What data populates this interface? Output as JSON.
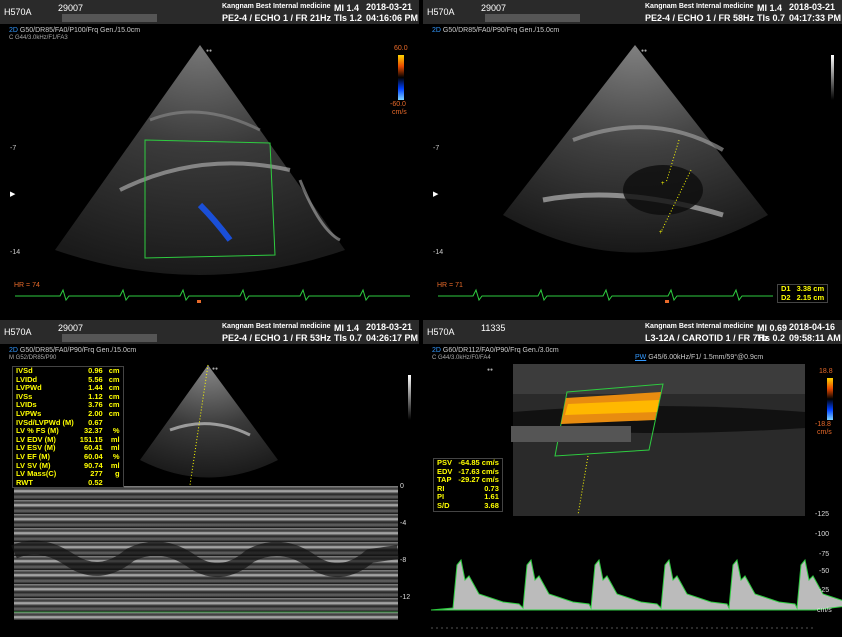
{
  "panels": {
    "q1": {
      "model": "H570A",
      "patient_id": "29007",
      "institution": "Kangnam Best Internal medicine",
      "probe": "PE2-4 / ECHO 1 / FR 21Hz",
      "mi": "MI  1.4",
      "tis": "TIs 1.2",
      "date": "2018-03-21",
      "time": "04:16:06 PM",
      "mode": "2D",
      "params": "G50/DR85/FA0/P100/Frq Gen./15.0cm",
      "params2": "C G44/3.0kHz/F1/FA3",
      "hr": "HR = 74",
      "depth": [
        "-7",
        "-14"
      ],
      "color_scale": {
        "top": "60.0",
        "bottom": "-60.0",
        "unit": "cm/s"
      }
    },
    "q2": {
      "model": "H570A",
      "patient_id": "29007",
      "institution": "Kangnam Best Internal medicine",
      "probe": "PE2-4 / ECHO 1 / FR 58Hz",
      "mi": "MI  1.4",
      "tis": "TIs 0.7",
      "date": "2018-03-21",
      "time": "04:17:33 PM",
      "mode": "2D",
      "params": "G50/DR85/FA0/P90/Frq Gen./15.0cm",
      "hr": "HR = 71",
      "depth": [
        "-7",
        "-14"
      ],
      "measurements": [
        {
          "label": "D1",
          "value": "3.38 cm"
        },
        {
          "label": "D2",
          "value": "2.15 cm"
        }
      ]
    },
    "q3": {
      "model": "H570A",
      "patient_id": "29007",
      "institution": "Kangnam Best Internal medicine",
      "probe": "PE2-4 / ECHO 1 / FR 53Hz",
      "mi": "MI  1.4",
      "tis": "TIs 0.7",
      "date": "2018-03-21",
      "time": "04:26:17 PM",
      "mode": "2D",
      "params": "G50/DR85/FA0/P90/Frq Gen./15.0cm",
      "params2": "M G52/DR85/P90",
      "mmode_scale": [
        "0",
        "-4",
        "-8",
        "-12"
      ],
      "measurements": [
        {
          "label": "IVSd",
          "value": "0.96",
          "unit": "cm"
        },
        {
          "label": "LVIDd",
          "value": "5.56",
          "unit": "cm"
        },
        {
          "label": "LVPWd",
          "value": "1.44",
          "unit": "cm"
        },
        {
          "label": "IVSs",
          "value": "1.12",
          "unit": "cm"
        },
        {
          "label": "LVIDs",
          "value": "3.76",
          "unit": "cm"
        },
        {
          "label": "LVPWs",
          "value": "2.00",
          "unit": "cm"
        },
        {
          "label": "IVSd/LVPWd (M)",
          "value": "0.67",
          "unit": ""
        },
        {
          "label": "LV % FS (M)",
          "value": "32.37",
          "unit": "%"
        },
        {
          "label": "LV EDV (M)",
          "value": "151.15",
          "unit": "ml"
        },
        {
          "label": "LV ESV (M)",
          "value": "60.41",
          "unit": "ml"
        },
        {
          "label": "LV EF (M)",
          "value": "60.04",
          "unit": "%"
        },
        {
          "label": "LV SV (M)",
          "value": "90.74",
          "unit": "ml"
        },
        {
          "label": "LV Mass(C)",
          "value": "277",
          "unit": "g"
        },
        {
          "label": "RWT",
          "value": "0.52",
          "unit": ""
        }
      ]
    },
    "q4": {
      "model": "H570A",
      "patient_id": "11335",
      "institution": "Kangnam Best Internal medicine",
      "probe": "L3-12A / CAROTID 1 / FR 7Hz",
      "mi": "MI  0.69",
      "tis": "TIs 0.2",
      "date": "2018-04-16",
      "time": "09:58:11 AM",
      "mode": "2D",
      "params": "G60/DR112/FA0/P90/Frq Gen./3.0cm",
      "params2": "C G44/3.0kHz/F0/FA4",
      "pw_mode": "PW",
      "pw_params": "G45/6.00kHz/F1/ 1.5mm/59°@0.9cm",
      "color_scale": {
        "top": "18.8",
        "bottom": "-18.8",
        "unit": "cm/s"
      },
      "velocity_scale": [
        "-125",
        "-100",
        "-75",
        "-50",
        "-25"
      ],
      "velocity_unit": "cm/s",
      "measurements": [
        {
          "label": "PSV",
          "value": "-64.85 cm/s"
        },
        {
          "label": "EDV",
          "value": "-17.63 cm/s"
        },
        {
          "label": "TAP",
          "value": "-29.27 cm/s"
        },
        {
          "label": "RI",
          "value": "0.73"
        },
        {
          "label": "PI",
          "value": "1.61"
        },
        {
          "label": "S/D",
          "value": "3.68"
        }
      ]
    }
  },
  "icons": [
    "samsung-logo-icon",
    "probe-indicator-icon",
    "focus-marker-icon"
  ],
  "colors": {
    "header_bg": "#2a2a2a",
    "measurement_text": "#ffff00",
    "ecg_trace": "#2ecc40",
    "hr_text": "#e86a2a",
    "mode_blue": "#3399ff"
  }
}
